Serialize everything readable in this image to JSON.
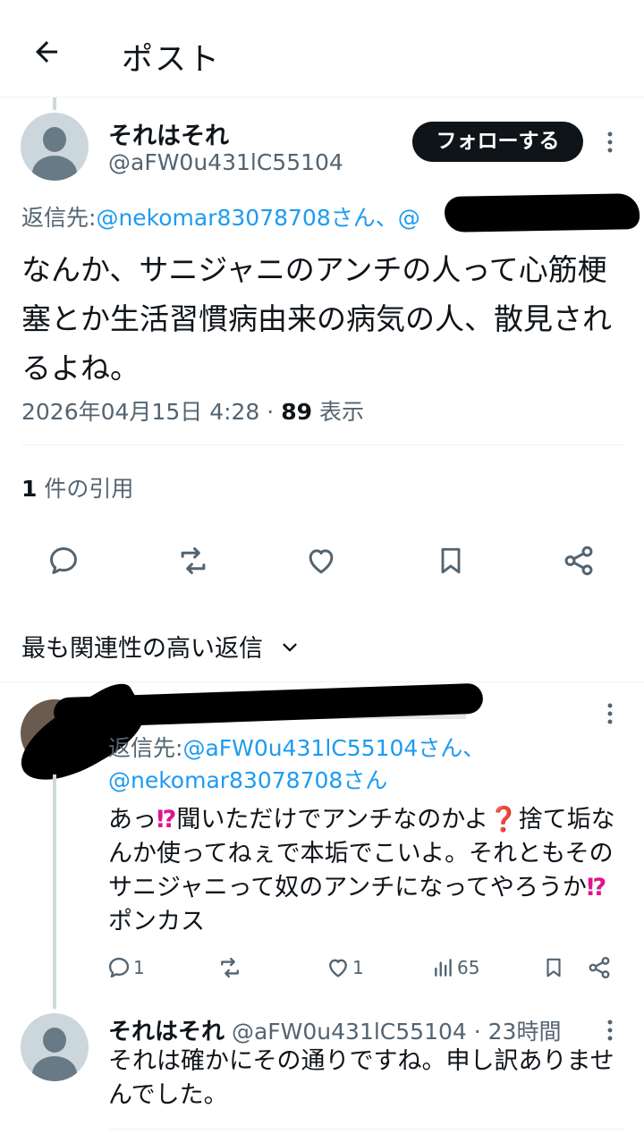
{
  "header": {
    "title": "ポスト"
  },
  "main_post": {
    "display_name": "それはそれ",
    "handle": "@aFW0u431lC55104",
    "follow_label": "フォローする",
    "reply_to_label": "返信先:",
    "reply_to_handle": "@nekomar83078708さん、",
    "reply_to_extra": "@",
    "text": "なんか、サニジャニのアンチの人って心筋梗塞とか生活習慣病由来の病気の人、散見されるよね。",
    "timestamp": "2026年04月15日 4:28",
    "separator": "·",
    "views_count": "89",
    "views_label": "表示",
    "quotes_count": "1",
    "quotes_label": "件の引用"
  },
  "sort": {
    "label": "最も関連性の高い返信"
  },
  "reply1": {
    "reply_to_label": "返信先:",
    "reply_to_handle1": "@aFW0u431lC55104さん、",
    "reply_to_handle2": "@nekomar83078708さん",
    "text_part1": "あっ",
    "emoji1": "⁉",
    "text_part2": "聞いただけでアンチなのかよ",
    "emoji2": "❓",
    "text_part3": "捨て垢なんか使ってねぇで本垢でこいよ。それともそのサニジャニって奴のアンチになってやろうか",
    "emoji3": "⁉",
    "text_part4": "ポンカス",
    "reply_count": "1",
    "like_count": "1",
    "view_count": "65"
  },
  "reply2": {
    "display_name": "それはそれ",
    "handle": "@aFW0u431lC55104",
    "separator": "·",
    "time": "23時間",
    "text": "それは確かにその通りですね。申し訳ありませんでした。"
  }
}
